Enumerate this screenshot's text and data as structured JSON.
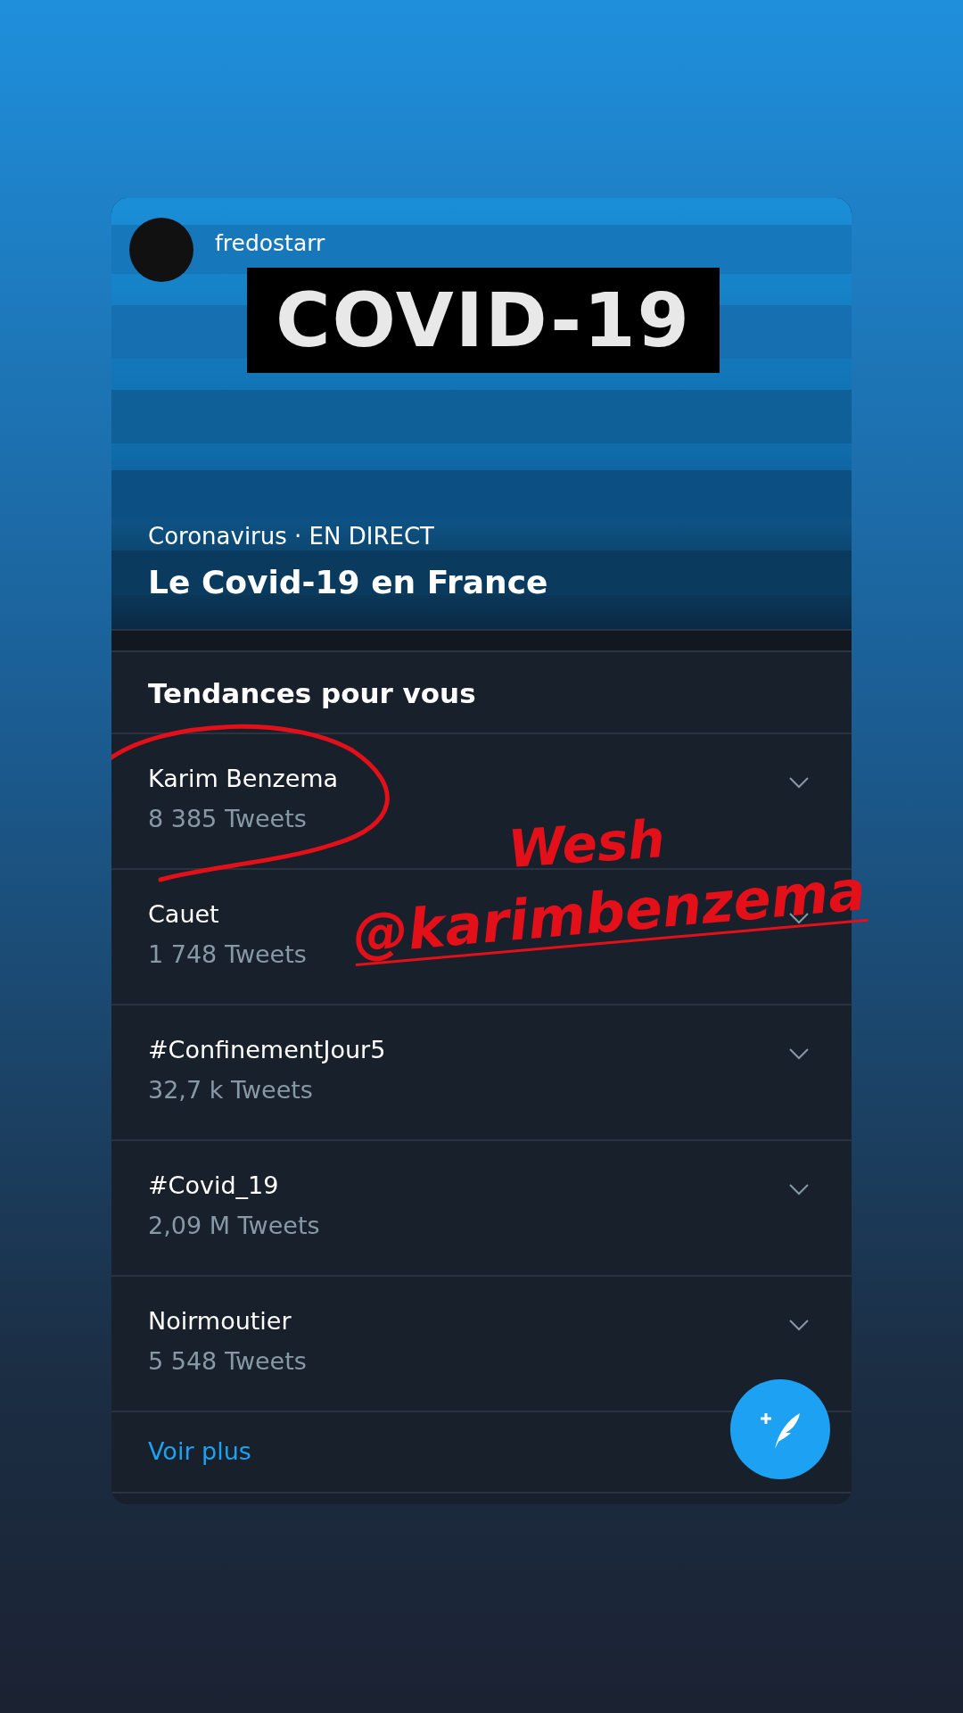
{
  "story": {
    "username": "fredostarr"
  },
  "banner": {
    "kind": "picture",
    "label": "COVID-19",
    "category": "Coronavirus · EN DIRECT",
    "title": "Le Covid-19 en France"
  },
  "trends": {
    "heading": "Tendances pour vous",
    "items": [
      {
        "name": "Karim Benzema",
        "count": "8 385 Tweets"
      },
      {
        "name": "Cauet",
        "count": "1 748 Tweets"
      },
      {
        "name": "#ConfinementJour5",
        "count": "32,7 k Tweets"
      },
      {
        "name": "#Covid_19",
        "count": "2,09 M Tweets"
      },
      {
        "name": "Noirmoutier",
        "count": "5 548 Tweets"
      }
    ],
    "more": "Voir plus"
  },
  "annotations": [
    {
      "kind": "text",
      "text": "Wesh"
    },
    {
      "kind": "mention",
      "text": "@karimbenzema"
    }
  ]
}
